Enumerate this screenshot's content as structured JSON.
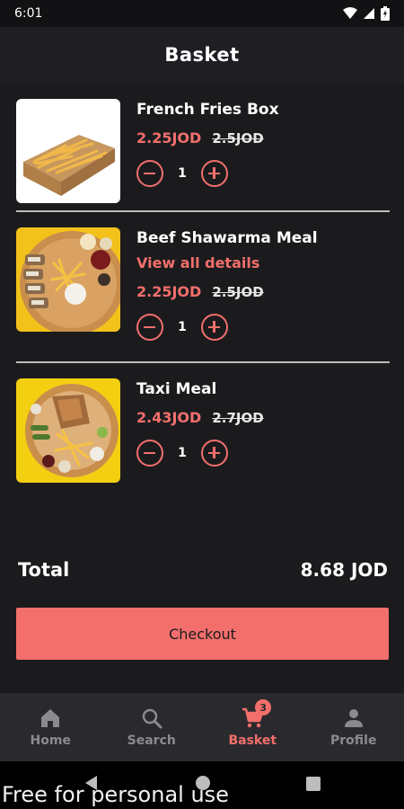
{
  "status_bar": {
    "time": "6:01",
    "icons": [
      "wifi-icon",
      "signal-icon",
      "battery-icon"
    ]
  },
  "header": {
    "title": "Basket"
  },
  "basket_items": [
    {
      "name": "French Fries Box",
      "details_link": "",
      "price": "2.25JOD",
      "old_price": "2.5JOD",
      "quantity": "1",
      "image": "french-fries-image"
    },
    {
      "name": "Beef Shawarma Meal",
      "details_link": "View all details",
      "price": "2.25JOD",
      "old_price": "2.5JOD",
      "quantity": "1",
      "image": "shawarma-image"
    },
    {
      "name": "Taxi Meal",
      "details_link": "",
      "price": "2.43JOD",
      "old_price": "2.7JOD",
      "quantity": "1",
      "image": "taxi-meal-image"
    }
  ],
  "summary": {
    "total_label": "Total",
    "total_value": "8.68 JOD"
  },
  "checkout": {
    "label": "Checkout"
  },
  "bottom_nav": [
    {
      "label": "Home",
      "icon": "home-icon",
      "active": false
    },
    {
      "label": "Search",
      "icon": "search-icon",
      "active": false
    },
    {
      "label": "Basket",
      "icon": "cart-icon",
      "active": true,
      "badge": "3"
    },
    {
      "label": "Profile",
      "icon": "person-icon",
      "active": false
    }
  ],
  "watermark": "Free for personal use",
  "colors": {
    "accent": "#f26f6c",
    "background": "#1b1b1e",
    "nav_background": "#2a2a2e"
  }
}
